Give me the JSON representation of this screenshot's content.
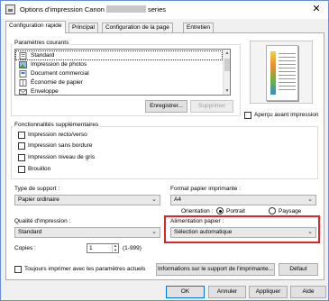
{
  "window": {
    "title_prefix": "Options d'impression Canon",
    "title_suffix": "series",
    "close": "✕"
  },
  "tabs": [
    {
      "label": "Configuration rapide"
    },
    {
      "label": "Principal"
    },
    {
      "label": "Configuration de la page"
    },
    {
      "label": "Entretien"
    }
  ],
  "profiles": {
    "label": "Paramètres courants",
    "items": [
      {
        "label": "Standard"
      },
      {
        "label": "Impression de photos"
      },
      {
        "label": "Document commercial"
      },
      {
        "label": "Économie de papier"
      },
      {
        "label": "Enveloppe"
      }
    ],
    "save_button": "Enregistrer...",
    "delete_button": "Supprimer"
  },
  "preview": {
    "checkbox_label": "Aperçu avant impression"
  },
  "features": {
    "label": "Fonctionnalités supplémentaires",
    "items": [
      {
        "label": "Impression recto/verso"
      },
      {
        "label": "Impression sans bordure"
      },
      {
        "label": "Impression niveau de gris"
      },
      {
        "label": "Brouillon"
      }
    ]
  },
  "media": {
    "label": "Type de support :",
    "value": "Papier ordinaire"
  },
  "paper_size": {
    "label": "Format papier imprimante :",
    "value": "A4"
  },
  "orientation": {
    "label": "Orientation :",
    "portrait": "Portrait",
    "landscape": "Paysage"
  },
  "quality": {
    "label": "Qualité d'impression :",
    "value": "Standard"
  },
  "paper_source": {
    "label": "Alimentation papier :",
    "value": "Sélection automatique"
  },
  "copies": {
    "label": "Copies :",
    "value": "1",
    "range": "(1-999)"
  },
  "always_print": {
    "label": "Toujours imprimer avec les paramètres actuels"
  },
  "buttons": {
    "media_info": "Informations sur le support de l'imprimante...",
    "default": "Défaut",
    "ok": "OK",
    "cancel": "Annuler",
    "apply": "Appliquer",
    "help": "Aide"
  },
  "colors": {
    "highlight": "#d9272a",
    "accent": "#0078d7"
  }
}
